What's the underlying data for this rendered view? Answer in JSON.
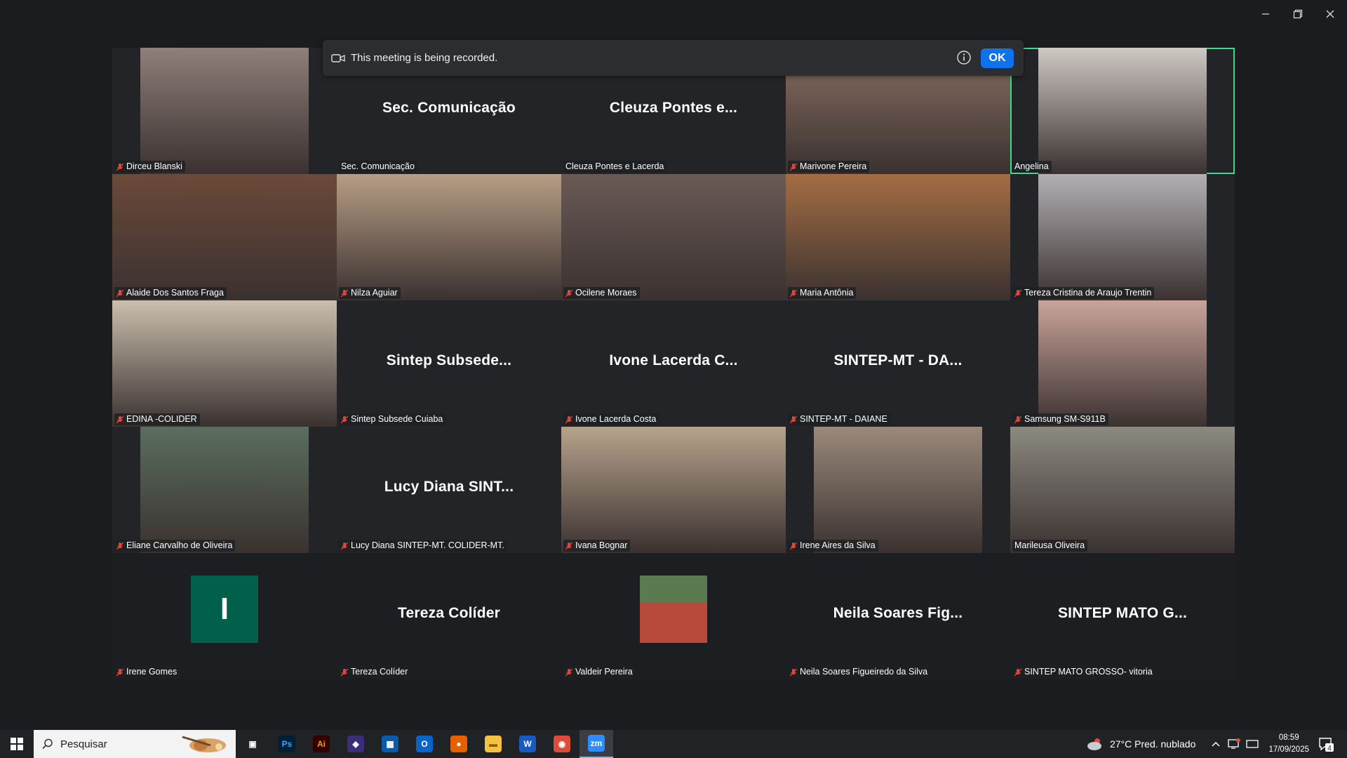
{
  "window": {
    "controls": [
      "minimize",
      "restore",
      "close"
    ]
  },
  "recording_notice": {
    "message": "This meeting is being recorded.",
    "ok_label": "OK"
  },
  "tiles": [
    {
      "label": "Dirceu Blanski",
      "big": "",
      "muted": true,
      "video": "#8f7f79"
    },
    {
      "label": "Sec. Comunicação",
      "big": "Sec. Comunicação",
      "muted": false,
      "video": ""
    },
    {
      "label": "Cleuza Pontes e Lacerda",
      "big": "Cleuza Pontes e...",
      "muted": false,
      "video": ""
    },
    {
      "label": "Marivone Pereira",
      "big": "",
      "muted": true,
      "video": "#8a6f60"
    },
    {
      "label": "Angelina",
      "big": "",
      "muted": false,
      "video": "#cfc9c4",
      "active": true
    },
    {
      "label": "Alaide Dos Santos Fraga",
      "big": "",
      "muted": true,
      "video": "#6b4a3a"
    },
    {
      "label": "Nilza Aguiar",
      "big": "",
      "muted": true,
      "video": "#b79e85"
    },
    {
      "label": "Ocilene Moraes",
      "big": "",
      "muted": true,
      "video": "#6a5a55"
    },
    {
      "label": "Maria Antônia",
      "big": "",
      "muted": true,
      "video": "#a46d44"
    },
    {
      "label": "Tereza Cristina de Araujo Trentin",
      "big": "",
      "muted": true,
      "video": "#b3b0b4"
    },
    {
      "label": "EDINA -COLIDER",
      "big": "",
      "muted": true,
      "video": "#cbbfae"
    },
    {
      "label": "Sintep Subsede Cuiaba",
      "big": "Sintep Subsede...",
      "muted": true,
      "video": ""
    },
    {
      "label": "Ivone Lacerda Costa",
      "big": "Ivone Lacerda C...",
      "muted": true,
      "video": ""
    },
    {
      "label": "SINTEP-MT - DAIANE",
      "big": "SINTEP-MT - DA...",
      "muted": true,
      "video": ""
    },
    {
      "label": "Samsung SM-S911B",
      "big": "",
      "muted": true,
      "video": "#c9a49a"
    },
    {
      "label": "Eliane Carvalho de Oliveira",
      "big": "",
      "muted": true,
      "video": "#5a6e5e"
    },
    {
      "label": "Lucy Diana  SINTEP-MT. COLIDER-MT.",
      "big": "Lucy Diana  SINT...",
      "muted": true,
      "video": ""
    },
    {
      "label": "Ivana Bognar",
      "big": "",
      "muted": true,
      "video": "#b7a38c"
    },
    {
      "label": "Irene Aires da Silva",
      "big": "",
      "muted": true,
      "video": "#9b8a7b"
    },
    {
      "label": "Marileusa Oliveira",
      "big": "",
      "muted": false,
      "video": "#8c8a80"
    },
    {
      "label": "Irene Gomes",
      "big": "",
      "muted": true,
      "video": "",
      "avatar_letter": "I",
      "avatar_color": "#00604a"
    },
    {
      "label": "Tereza Colíder",
      "big": "Tereza Colíder",
      "muted": true,
      "video": ""
    },
    {
      "label": "Valdeir Pereira",
      "big": "",
      "muted": true,
      "video": "",
      "avatar_photo": "#b84a3c"
    },
    {
      "label": "Neila Soares Figueiredo da Silva",
      "big": "Neila Soares Fig...",
      "muted": true,
      "video": ""
    },
    {
      "label": "SINTEP MATO GROSSO- vitoria",
      "big": "SINTEP MATO G...",
      "muted": true,
      "video": ""
    }
  ],
  "taskbar": {
    "search_placeholder": "Pesquisar",
    "apps": [
      "task-view-icon",
      "photoshop-icon",
      "illustrator-icon",
      "copilot-icon",
      "store-icon",
      "outlook-icon",
      "firefox-icon",
      "file-explorer-icon",
      "word-icon",
      "chrome-icon",
      "zoom-icon"
    ],
    "weather": "27°C  Pred. nublado",
    "time": "08:59",
    "date": "17/09/2025",
    "notifications": "4"
  }
}
